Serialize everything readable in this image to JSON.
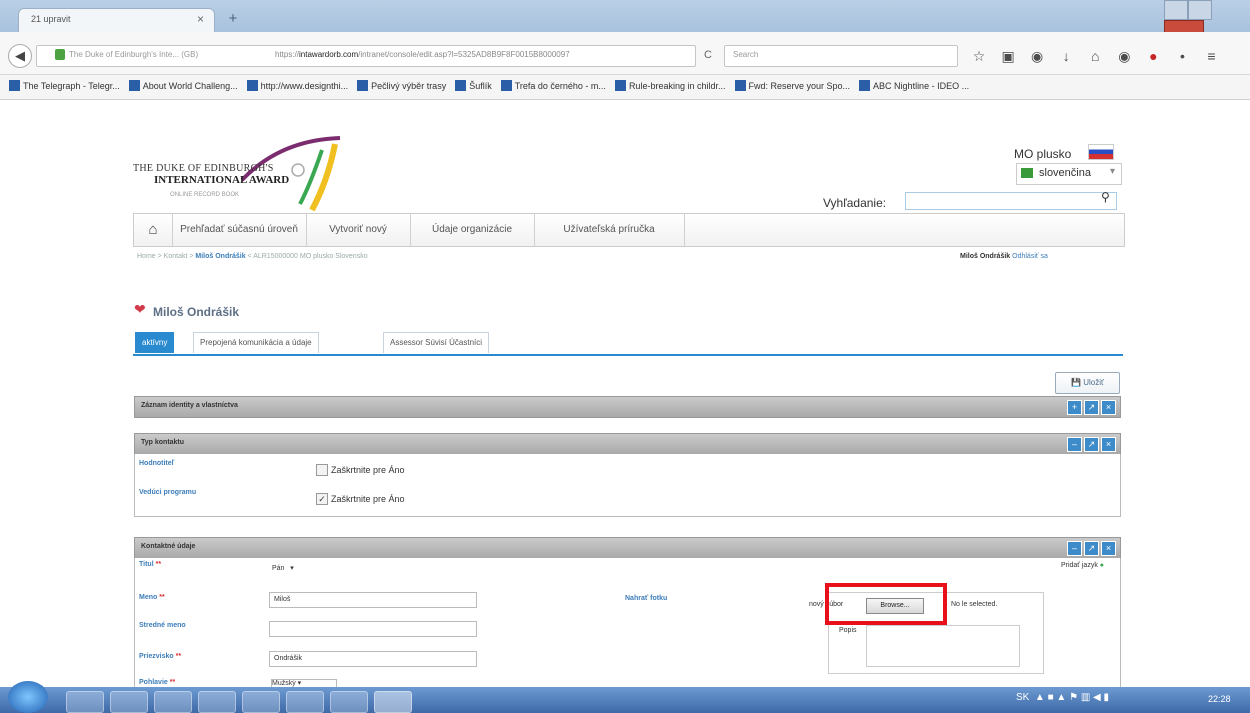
{
  "browser": {
    "tab_title": "21 upravit",
    "tab_close": "×",
    "new_tab": "+",
    "site_label": "The Duke of Edinburgh's Inte... (GB)",
    "address_prefix": "https://",
    "address_domain": "intawardorb.com",
    "address_rest": "/intranet/console/edit.asp?l=5325AD8B9F8F0015B8000097",
    "search_placeholder": "Search",
    "reload": "C"
  },
  "bookmarks": [
    "The Telegraph - Telegr...",
    "About World Challeng...",
    "http://www.designthi...",
    "Pečlivý výběr trasy",
    "Šuflík",
    "Trefa do černého - m...",
    "Rule-breaking in childr...",
    "Fwd: Reserve your Spo...",
    "ABC Nightline - IDEO ..."
  ],
  "logo": {
    "line1": "THE DUKE OF EDINBURGH'S",
    "line2": "INTERNATIONAL AWARD",
    "line3": "ONLINE RECORD BOOK"
  },
  "header": {
    "user": "MO plusko",
    "language": "slovenčina",
    "search_label": "Vyhľadanie:"
  },
  "nav": {
    "items": [
      "Prehľadať súčasnú úroveň",
      "Vytvoriť nový",
      "Údaje organizácie",
      "Užívateľská príručka"
    ]
  },
  "breadcrumb": {
    "home": "Home",
    "contacts": "Kontakt",
    "current": "Miloš Ondrášik",
    "rest": "ALR15000000 MO plusko Slovensko"
  },
  "user_bar": {
    "name": "Miloš Ondrášik",
    "logout": "Odhlásiť sa"
  },
  "page_title": "Miloš Ondrášik",
  "tabs": [
    "aktívny",
    "Prepojená komunikácia a údaje",
    "Assessor Súvisí Účastníci"
  ],
  "save_label": "Uložiť",
  "panels": {
    "identity": {
      "title": "Záznam identity a vlastníctva"
    },
    "contact_type": {
      "title": "Typ kontaktu",
      "rows": [
        {
          "label": "Hodnotiteľ",
          "checked": false,
          "text": "Zaškrtnite pre Áno"
        },
        {
          "label": "Vedúci programu",
          "checked": true,
          "text": "Zaškrtnite pre Áno"
        }
      ]
    },
    "contact_details": {
      "title": "Kontaktné údaje",
      "add_language": "Pridať jazyk",
      "fields": {
        "title_label": "Titul",
        "title_value": "Pán",
        "first_label": "Meno",
        "first_value": "Miloš",
        "middle_label": "Stredné meno",
        "middle_value": "",
        "last_label": "Priezvisko",
        "last_value": "Ondrášik",
        "gender_label": "Pohlavie",
        "gender_value": "Mužský",
        "photo_label": "Nahrať fotku",
        "file_prefix": "nový súbor",
        "browse": "Browse...",
        "no_file": "No    le selected.",
        "desc_label": "Popis"
      }
    }
  },
  "taskbar": {
    "lang": "SK",
    "clock": "22:28"
  }
}
